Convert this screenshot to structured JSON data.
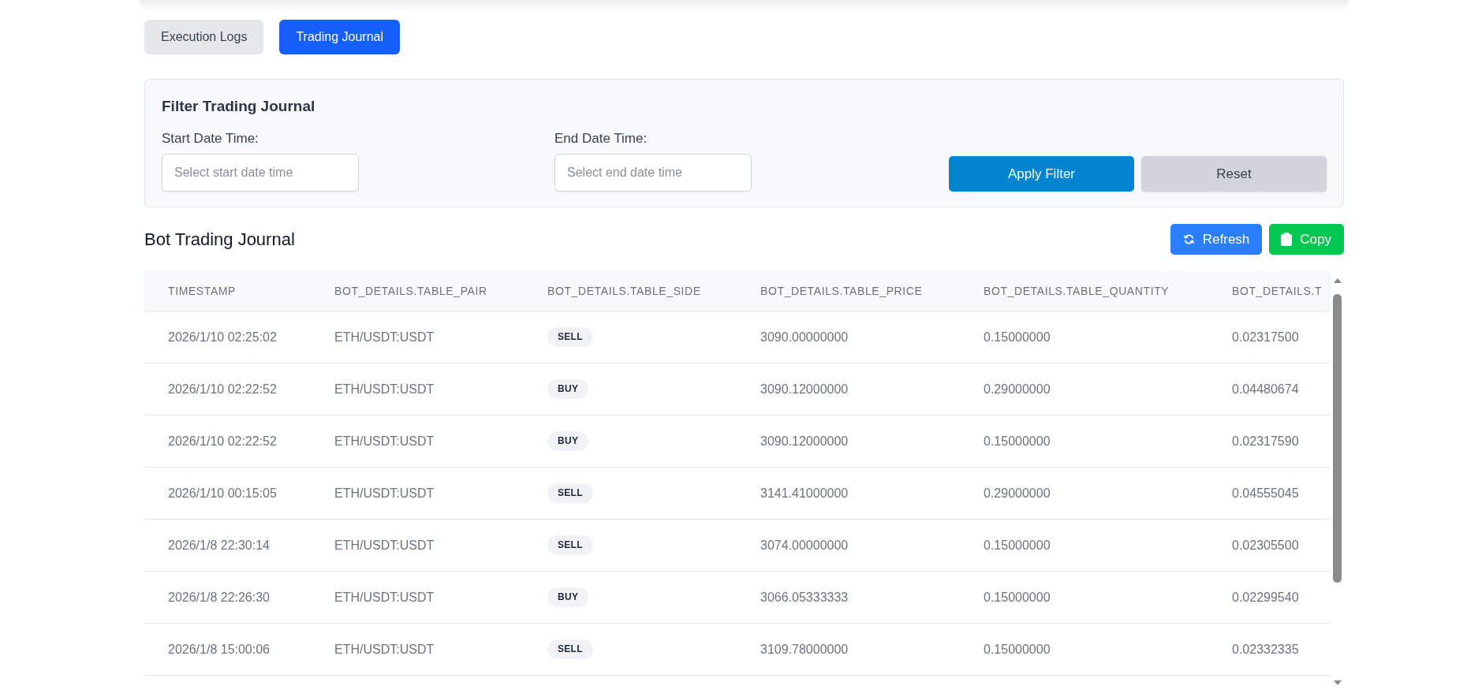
{
  "tabs": [
    {
      "label": "Execution Logs",
      "selected": false
    },
    {
      "label": "Trading Journal",
      "selected": true
    }
  ],
  "filter": {
    "title": "Filter Trading Journal",
    "fields": [
      {
        "label": "Start Date Time:",
        "placeholder": "Select start date time"
      },
      {
        "label": "End Date Time:",
        "placeholder": "Select end date time"
      }
    ],
    "buttons": [
      {
        "label": "Apply Filter",
        "kind": "primary"
      },
      {
        "label": "Reset",
        "kind": "secondary"
      }
    ]
  },
  "journal": {
    "title": "Bot Trading Journal",
    "actions": [
      {
        "label": "Refresh",
        "kind": "refresh"
      },
      {
        "label": "Copy",
        "kind": "copy"
      }
    ],
    "table": {
      "columns": [
        "TIMESTAMP",
        "BOT_DETAILS.TABLE_PAIR",
        "BOT_DETAILS.TABLE_SIDE",
        "BOT_DETAILS.TABLE_PRICE",
        "BOT_DETAILS.TABLE_QUANTITY",
        "BOT_DETAILS.T"
      ],
      "rows": [
        {
          "timestamp": "2026/1/10 02:25:02",
          "pair": "ETH/USDT:USDT",
          "side": "SELL",
          "price": "3090.00000000",
          "quantity": "0.15000000",
          "column_6": "0.02317500"
        },
        {
          "timestamp": "2026/1/10 02:22:52",
          "pair": "ETH/USDT:USDT",
          "side": "BUY",
          "price": "3090.12000000",
          "quantity": "0.29000000",
          "column_6": "0.04480674"
        },
        {
          "timestamp": "2026/1/10 02:22:52",
          "pair": "ETH/USDT:USDT",
          "side": "BUY",
          "price": "3090.12000000",
          "quantity": "0.15000000",
          "column_6": "0.02317590"
        },
        {
          "timestamp": "2026/1/10 00:15:05",
          "pair": "ETH/USDT:USDT",
          "side": "SELL",
          "price": "3141.41000000",
          "quantity": "0.29000000",
          "column_6": "0.04555045"
        },
        {
          "timestamp": "2026/1/8 22:30:14",
          "pair": "ETH/USDT:USDT",
          "side": "SELL",
          "price": "3074.00000000",
          "quantity": "0.15000000",
          "column_6": "0.02305500"
        },
        {
          "timestamp": "2026/1/8 22:26:30",
          "pair": "ETH/USDT:USDT",
          "side": "BUY",
          "price": "3066.05333333",
          "quantity": "0.15000000",
          "column_6": "0.02299540"
        },
        {
          "timestamp": "2026/1/8 15:00:06",
          "pair": "ETH/USDT:USDT",
          "side": "SELL",
          "price": "3109.78000000",
          "quantity": "0.15000000",
          "column_6": "0.02332335"
        }
      ]
    }
  }
}
